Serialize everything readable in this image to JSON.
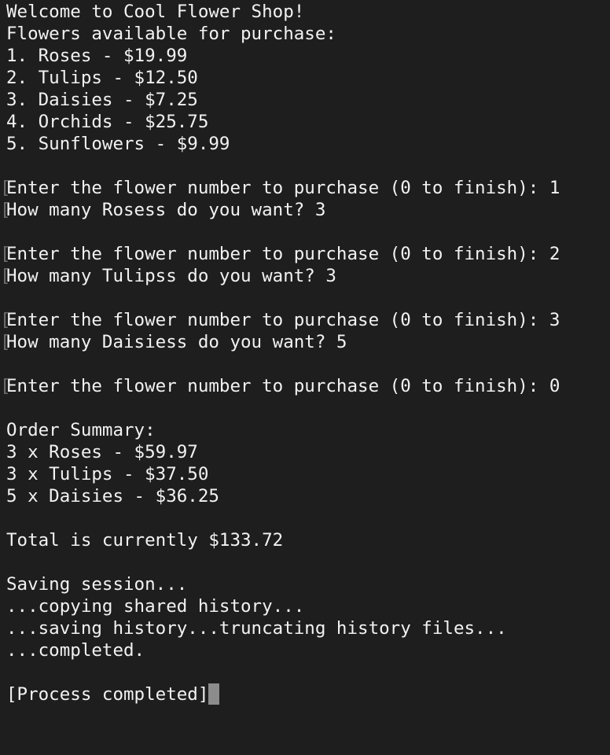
{
  "theme": {
    "background": "#1e1e1e",
    "foreground": "#f2f2f2",
    "mark_color": "#6e6e6e",
    "cursor_color": "#8c8c8c"
  },
  "terminal": {
    "lines": [
      {
        "text": "Welcome to Cool Flower Shop!",
        "mark": false
      },
      {
        "text": "Flowers available for purchase:",
        "mark": false
      },
      {
        "text": "1. Roses - $19.99",
        "mark": false
      },
      {
        "text": "2. Tulips - $12.50",
        "mark": false
      },
      {
        "text": "3. Daisies - $7.25",
        "mark": false
      },
      {
        "text": "4. Orchids - $25.75",
        "mark": false
      },
      {
        "text": "5. Sunflowers - $9.99",
        "mark": false
      },
      {
        "text": "",
        "mark": false
      },
      {
        "text": "Enter the flower number to purchase (0 to finish): 1",
        "mark": true
      },
      {
        "text": "How many Rosess do you want? 3",
        "mark": true
      },
      {
        "text": "",
        "mark": false
      },
      {
        "text": "Enter the flower number to purchase (0 to finish): 2",
        "mark": true
      },
      {
        "text": "How many Tulipss do you want? 3",
        "mark": true
      },
      {
        "text": "",
        "mark": false
      },
      {
        "text": "Enter the flower number to purchase (0 to finish): 3",
        "mark": true
      },
      {
        "text": "How many Daisiess do you want? 5",
        "mark": true
      },
      {
        "text": "",
        "mark": false
      },
      {
        "text": "Enter the flower number to purchase (0 to finish): 0",
        "mark": true
      },
      {
        "text": "",
        "mark": false
      },
      {
        "text": "Order Summary:",
        "mark": false
      },
      {
        "text": "3 x Roses - $59.97",
        "mark": false
      },
      {
        "text": "3 x Tulips - $37.50",
        "mark": false
      },
      {
        "text": "5 x Daisies - $36.25",
        "mark": false
      },
      {
        "text": "",
        "mark": false
      },
      {
        "text": "Total is currently $133.72",
        "mark": false
      },
      {
        "text": "",
        "mark": false
      },
      {
        "text": "Saving session...",
        "mark": false
      },
      {
        "text": "...copying shared history...",
        "mark": false
      },
      {
        "text": "...saving history...truncating history files...",
        "mark": false
      },
      {
        "text": "...completed.",
        "mark": false
      },
      {
        "text": "",
        "mark": false
      },
      {
        "text": "[Process completed]",
        "mark": false,
        "cursor": true
      }
    ],
    "mark_glyph": "["
  }
}
